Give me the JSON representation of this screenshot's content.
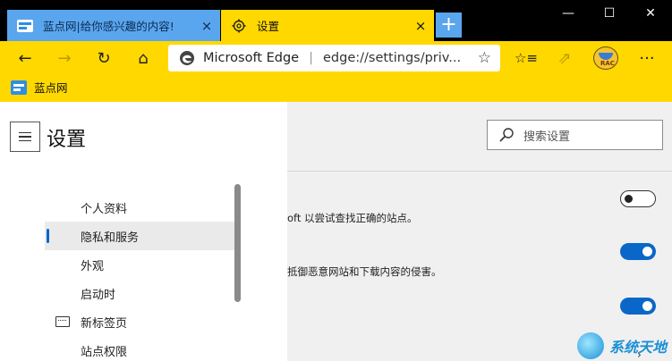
{
  "tabs": [
    {
      "title": "蓝点网|给你感兴趣的内容!",
      "icon": "bluedot-site-icon",
      "close": "×"
    },
    {
      "title": "设置",
      "icon": "gear-icon",
      "close": "×"
    }
  ],
  "new_tab": "+",
  "window_controls": {
    "minimize": "—",
    "maximize": "☐",
    "close": "✕"
  },
  "toolbar": {
    "back": "←",
    "forward": "→",
    "refresh": "↻",
    "home": "⌂",
    "favorites": "☆≡",
    "share": "⇗",
    "more": "···"
  },
  "address": {
    "site_name": "Microsoft Edge",
    "divider": "|",
    "url": "edge://settings/priv...",
    "star": "☆"
  },
  "avatar_tag": "RAC",
  "favorites_bar": {
    "item": "蓝点网"
  },
  "settings": {
    "title": "设置",
    "search_placeholder": "搜索设置",
    "nav": [
      {
        "label": "个人资料"
      },
      {
        "label": "隐私和服务"
      },
      {
        "label": "外观"
      },
      {
        "label": "启动时"
      },
      {
        "label": "新标签页"
      },
      {
        "label": "站点权限"
      }
    ],
    "rows": [
      {
        "desc": "oft 以尝试查找正确的站点。",
        "state": "off"
      },
      {
        "desc": "抵御恶意网站和下载内容的侵害。",
        "state": "on"
      },
      {
        "desc": "",
        "state": "on"
      }
    ]
  },
  "watermark": "系统天地",
  "chevron": "›",
  "colors": {
    "accent": "#0a67c8",
    "toolbar": "#ffd800",
    "tab_active_other": "#5aa6ee"
  }
}
